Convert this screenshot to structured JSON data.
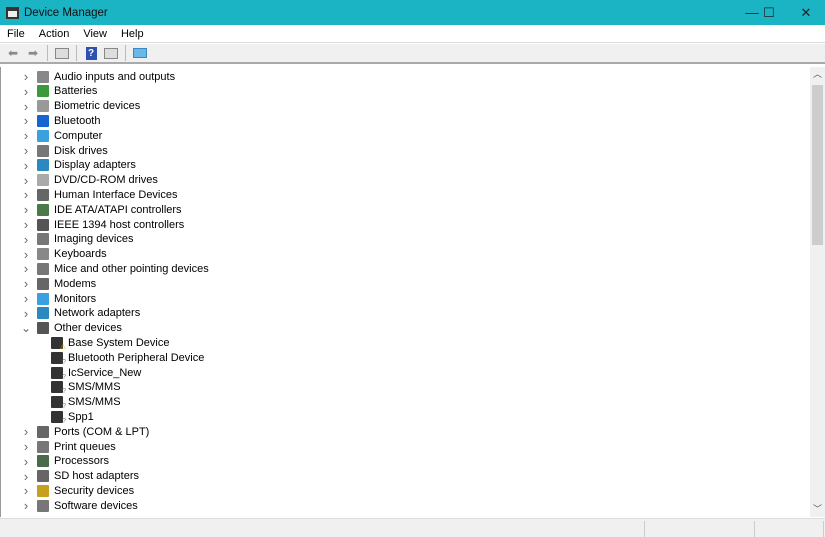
{
  "window": {
    "title": "Device Manager",
    "minimize": "—",
    "maximize": "☐",
    "close": "✕"
  },
  "menu": [
    "File",
    "Action",
    "View",
    "Help"
  ],
  "toolbar": {
    "help": "?"
  },
  "tree": [
    {
      "label": "Audio inputs and outputs",
      "color": "#888"
    },
    {
      "label": "Batteries",
      "color": "#3a9a3a"
    },
    {
      "label": "Biometric devices",
      "color": "#999"
    },
    {
      "label": "Bluetooth",
      "color": "#1464d2"
    },
    {
      "label": "Computer",
      "color": "#3aa0e0"
    },
    {
      "label": "Disk drives",
      "color": "#777"
    },
    {
      "label": "Display adapters",
      "color": "#2a8ac0"
    },
    {
      "label": "DVD/CD-ROM drives",
      "color": "#aaa"
    },
    {
      "label": "Human Interface Devices",
      "color": "#666"
    },
    {
      "label": "IDE ATA/ATAPI controllers",
      "color": "#4a7a4a"
    },
    {
      "label": "IEEE 1394 host controllers",
      "color": "#555"
    },
    {
      "label": "Imaging devices",
      "color": "#777"
    },
    {
      "label": "Keyboards",
      "color": "#888"
    },
    {
      "label": "Mice and other pointing devices",
      "color": "#777"
    },
    {
      "label": "Modems",
      "color": "#666"
    },
    {
      "label": "Monitors",
      "color": "#3aa0e0"
    },
    {
      "label": "Network adapters",
      "color": "#2a8ac0"
    },
    {
      "label": "Other devices",
      "color": "#555",
      "expanded": true,
      "children": [
        {
          "label": "Base System Device",
          "warn": true
        },
        {
          "label": "Bluetooth Peripheral Device"
        },
        {
          "label": "IcService_New"
        },
        {
          "label": "SMS/MMS"
        },
        {
          "label": "SMS/MMS"
        },
        {
          "label": "Spp1"
        }
      ]
    },
    {
      "label": "Ports (COM & LPT)",
      "color": "#666"
    },
    {
      "label": "Print queues",
      "color": "#777"
    },
    {
      "label": "Processors",
      "color": "#4a6a4a"
    },
    {
      "label": "SD host adapters",
      "color": "#666"
    },
    {
      "label": "Security devices",
      "color": "#c8a020"
    },
    {
      "label": "Software devices",
      "color": "#777"
    }
  ]
}
